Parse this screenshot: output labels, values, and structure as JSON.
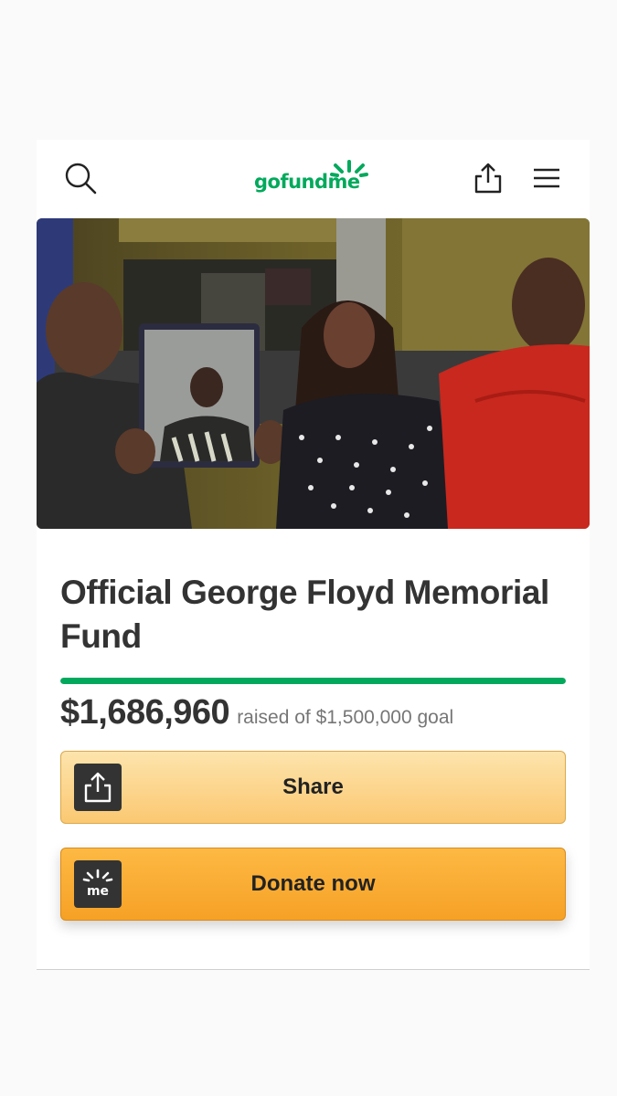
{
  "header": {
    "logo_text": "gofundme",
    "search_icon": "search-icon",
    "share_icon": "share-icon",
    "menu_icon": "menu-icon"
  },
  "campaign": {
    "title": "Official George Floyd Memorial Fund",
    "amount_raised": "$1,686,960",
    "goal_text": "raised of $1,500,000 goal",
    "progress_fraction": 1.0
  },
  "buttons": {
    "share_label": "Share",
    "donate_label": "Donate now",
    "donate_icon_text": "me"
  },
  "colors": {
    "brand_green": "#02a95c",
    "text_dark": "#333333",
    "text_muted": "#767676",
    "share_bg": "#fbd48a",
    "donate_bg": "#f8aa30"
  }
}
